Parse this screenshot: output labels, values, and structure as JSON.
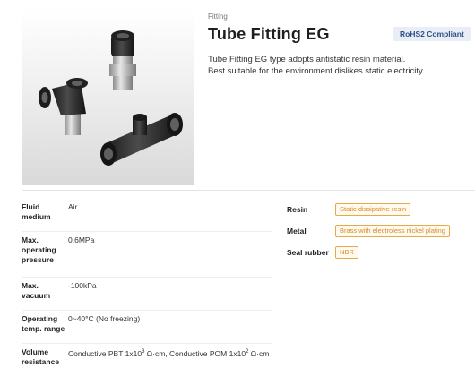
{
  "product": {
    "category": "Fitting",
    "title": "Tube Fitting EG",
    "badge": "RoHS2 Compliant",
    "description_lines": [
      "Tube Fitting EG type adopts antistatic resin material.",
      "Best suitable for the environment dislikes static electricity."
    ],
    "image_icon": "tube-fittings-photo"
  },
  "specs": [
    {
      "label_lines": [
        "Fluid",
        "medium"
      ],
      "value": "Air"
    },
    {
      "label_lines": [
        "Max.",
        "operating",
        "pressure"
      ],
      "value": "0.6MPa"
    },
    {
      "label_lines": [
        "Max.",
        "vacuum"
      ],
      "value": "-100kPa"
    },
    {
      "label_lines": [
        "Operating",
        "temp. range"
      ],
      "value": "0~40°C (No freezing)"
    },
    {
      "label_lines": [
        "Volume",
        "resistance"
      ],
      "value_a": "Conductive PBT 1x10",
      "value_a_exp": "3",
      "value_b": " Ω·cm, Conductive POM 1x10",
      "value_b_exp": "2",
      "value_c": " Ω·cm"
    }
  ],
  "materials": [
    {
      "label": "Resin",
      "value": "Static dissipative resin"
    },
    {
      "label": "Metal",
      "value": "Brass with electroless nickel plating"
    },
    {
      "label": "Seal rubber",
      "value": "NBR"
    }
  ],
  "colors": {
    "accent_orange": "#e7a94b",
    "badge_bg": "#e9eef6",
    "badge_text": "#2e4f86"
  }
}
